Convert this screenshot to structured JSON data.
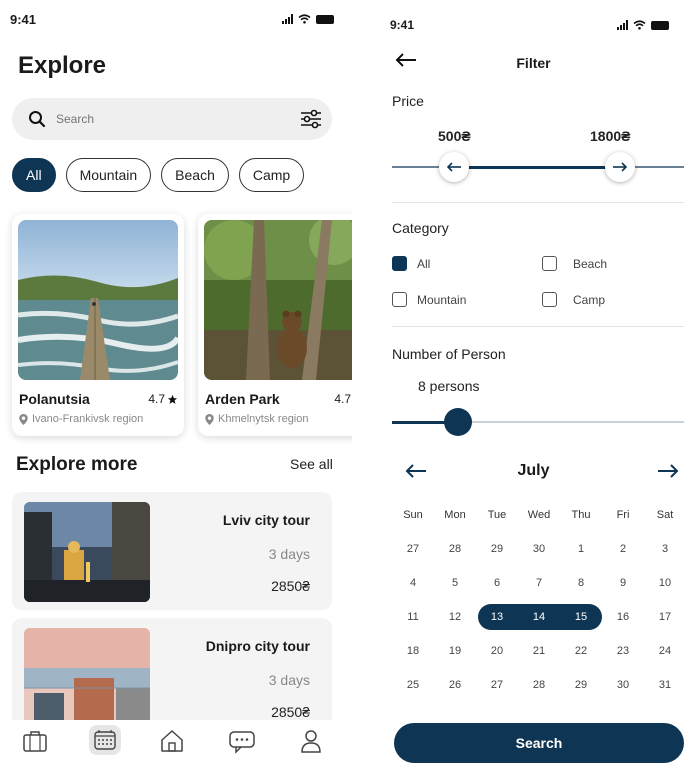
{
  "left_screen": {
    "status": {
      "time": "9:41"
    },
    "title": "Explore",
    "search": {
      "placeholder": "Search"
    },
    "chips": [
      {
        "label": "All",
        "active": true
      },
      {
        "label": "Mountain",
        "active": false
      },
      {
        "label": "Beach",
        "active": false
      },
      {
        "label": "Camp",
        "active": false
      }
    ],
    "places": [
      {
        "name": "Polanutsia",
        "rating": "4.7",
        "location": "Ivano-Frankivsk region"
      },
      {
        "name": "Arden Park",
        "rating": "4.7",
        "location": "Khmelnytsk region"
      }
    ],
    "explore_more": {
      "title": "Explore more",
      "see_all": "See all"
    },
    "tours": [
      {
        "name": "Lviv city tour",
        "days": "3 days",
        "price": "2850₴"
      },
      {
        "name": "Dnipro city tour",
        "days": "3 days",
        "price": "2850₴"
      }
    ],
    "nav_icons": [
      "briefcase-icon",
      "calendar-icon",
      "home-icon",
      "chat-icon",
      "profile-icon"
    ]
  },
  "right_screen": {
    "status": {
      "time": "9:41"
    },
    "title": "Filter",
    "price": {
      "label": "Price",
      "min": "500₴",
      "max": "1800₴"
    },
    "category": {
      "label": "Category",
      "options": [
        {
          "label": "All",
          "checked": true
        },
        {
          "label": "Beach",
          "checked": false
        },
        {
          "label": "Mountain",
          "checked": false
        },
        {
          "label": "Camp",
          "checked": false
        }
      ]
    },
    "persons": {
      "label": "Number of Person",
      "value": "8 persons"
    },
    "calendar": {
      "month": "July",
      "weekdays": [
        "Sun",
        "Mon",
        "Tue",
        "Wed",
        "Thu",
        "Fri",
        "Sat"
      ],
      "weeks": [
        [
          "27",
          "28",
          "29",
          "30",
          "1",
          "2",
          "3"
        ],
        [
          "4",
          "5",
          "6",
          "7",
          "8",
          "9",
          "10"
        ],
        [
          "11",
          "12",
          "13",
          "14",
          "15",
          "16",
          "17"
        ],
        [
          "18",
          "19",
          "20",
          "21",
          "22",
          "23",
          "24"
        ],
        [
          "25",
          "26",
          "27",
          "28",
          "29",
          "30",
          "31"
        ]
      ],
      "selected": [
        "13",
        "14",
        "15"
      ]
    },
    "search_button": "Search"
  },
  "colors": {
    "primary": "#0e3553",
    "chip_border": "#333333",
    "card_bg": "#f4f4f4"
  }
}
